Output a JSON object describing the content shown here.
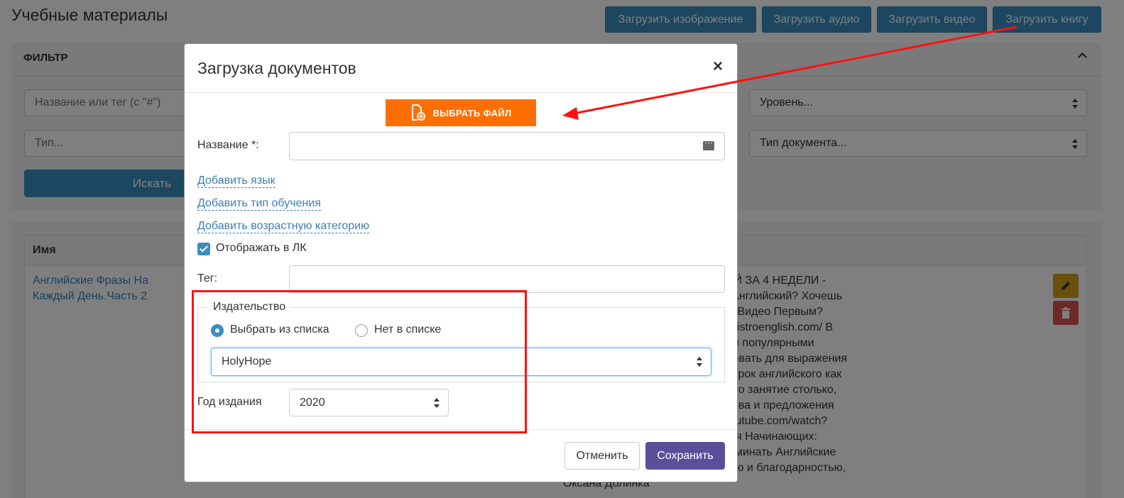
{
  "page": {
    "title": "Учебные материалы",
    "top_buttons": [
      "Загрузить изображение",
      "Загрузить аудио",
      "Загрузить видео",
      "Загрузить книгу"
    ]
  },
  "filter": {
    "heading": "ФИЛЬТР",
    "name_placeholder": "Название или тег (с \"#\")",
    "type_placeholder": "Тип...",
    "level_placeholder": "Уровень...",
    "doc_type_placeholder": "Тип документа...",
    "search_label": "Искать"
  },
  "table": {
    "col_name": "Имя",
    "row": {
      "name": "Английские Фразы На Каждый День.Часть 2",
      "description": "Для Начинающих - АНГЛИЙСКИЙ ЗА 4 НЕДЕЛИ -\n Дорогой Друг! Хочешь Выучить Английский? Хочешь\nОДА! Хочешь Узнавать О Новых Видео Первым?\nи Сообщения Здесь: http://www.bistroenglish.com/ В\nпознакомимся еще с некоторыми популярными\nи, которые ты сможешь использовать для выражения\nостаралась сделать этот видео-урок английского как\nдеюсь, эффективным! Смотри это занятие столько,\nьно повторяй все английские слова и предложения\nждый День Часть1: http://www.youtube.com/watch?\n_419LmiyuEUJHg Английский Для Начинающих:\n=5Z4_RLP7ytQ Как Учить и Запоминать Английские\nwatch?v=CMFcjP-SQj8 С любовью и благодарностью,\nОксана Долинка"
    }
  },
  "modal": {
    "title": "Загрузка документов",
    "close": "×",
    "choose_file": "ВЫБРАТЬ ФАЙЛ",
    "name_label": "Название *:",
    "name_value": "",
    "links": [
      "Добавить язык",
      "Добавить тип обучения",
      "Добавить возрастную категорию"
    ],
    "show_in_lk_label": "Отображать в ЛК",
    "show_in_lk_checked": true,
    "tag_label": "Тег:",
    "tag_value": "",
    "publisher": {
      "legend": "Издательство",
      "option_list": "Выбрать из списка",
      "option_not_listed": "Нет в списке",
      "selected_option": "Выбрать из списка",
      "value": "HolyHope"
    },
    "year_label": "Год издания",
    "year_value": "2020",
    "cancel_label": "Отменить",
    "save_label": "Сохранить"
  },
  "colors": {
    "primary": "#3a8ec1",
    "orange": "#ff6f00",
    "save": "#5b4f9c",
    "annotation": "#ff1111",
    "edit": "#d4a01a",
    "delete": "#d9534f"
  }
}
